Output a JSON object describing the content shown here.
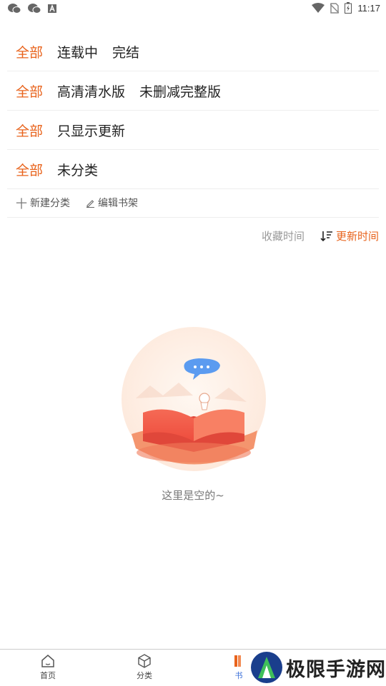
{
  "status_bar": {
    "time": "11:17"
  },
  "filters": [
    {
      "active": "全部",
      "options": [
        "连载中",
        "完结"
      ]
    },
    {
      "active": "全部",
      "options": [
        "高清清水版",
        "未删减完整版"
      ]
    },
    {
      "active": "全部",
      "options": [
        "只显示更新"
      ]
    },
    {
      "active": "全部",
      "options": [
        "未分类"
      ]
    }
  ],
  "actions": {
    "new_category": "新建分类",
    "edit_shelf": "编辑书架"
  },
  "sort": {
    "favorite_time": "收藏时间",
    "update_time": "更新时间",
    "selected": "更新时间"
  },
  "empty": {
    "message": "这里是空的~"
  },
  "nav": {
    "home": "首页",
    "category": "分类",
    "shelf": "书"
  },
  "watermark": {
    "text": "极限手游网"
  },
  "colors": {
    "accent": "#e8631c",
    "nav_active": "#3b6fd8"
  }
}
